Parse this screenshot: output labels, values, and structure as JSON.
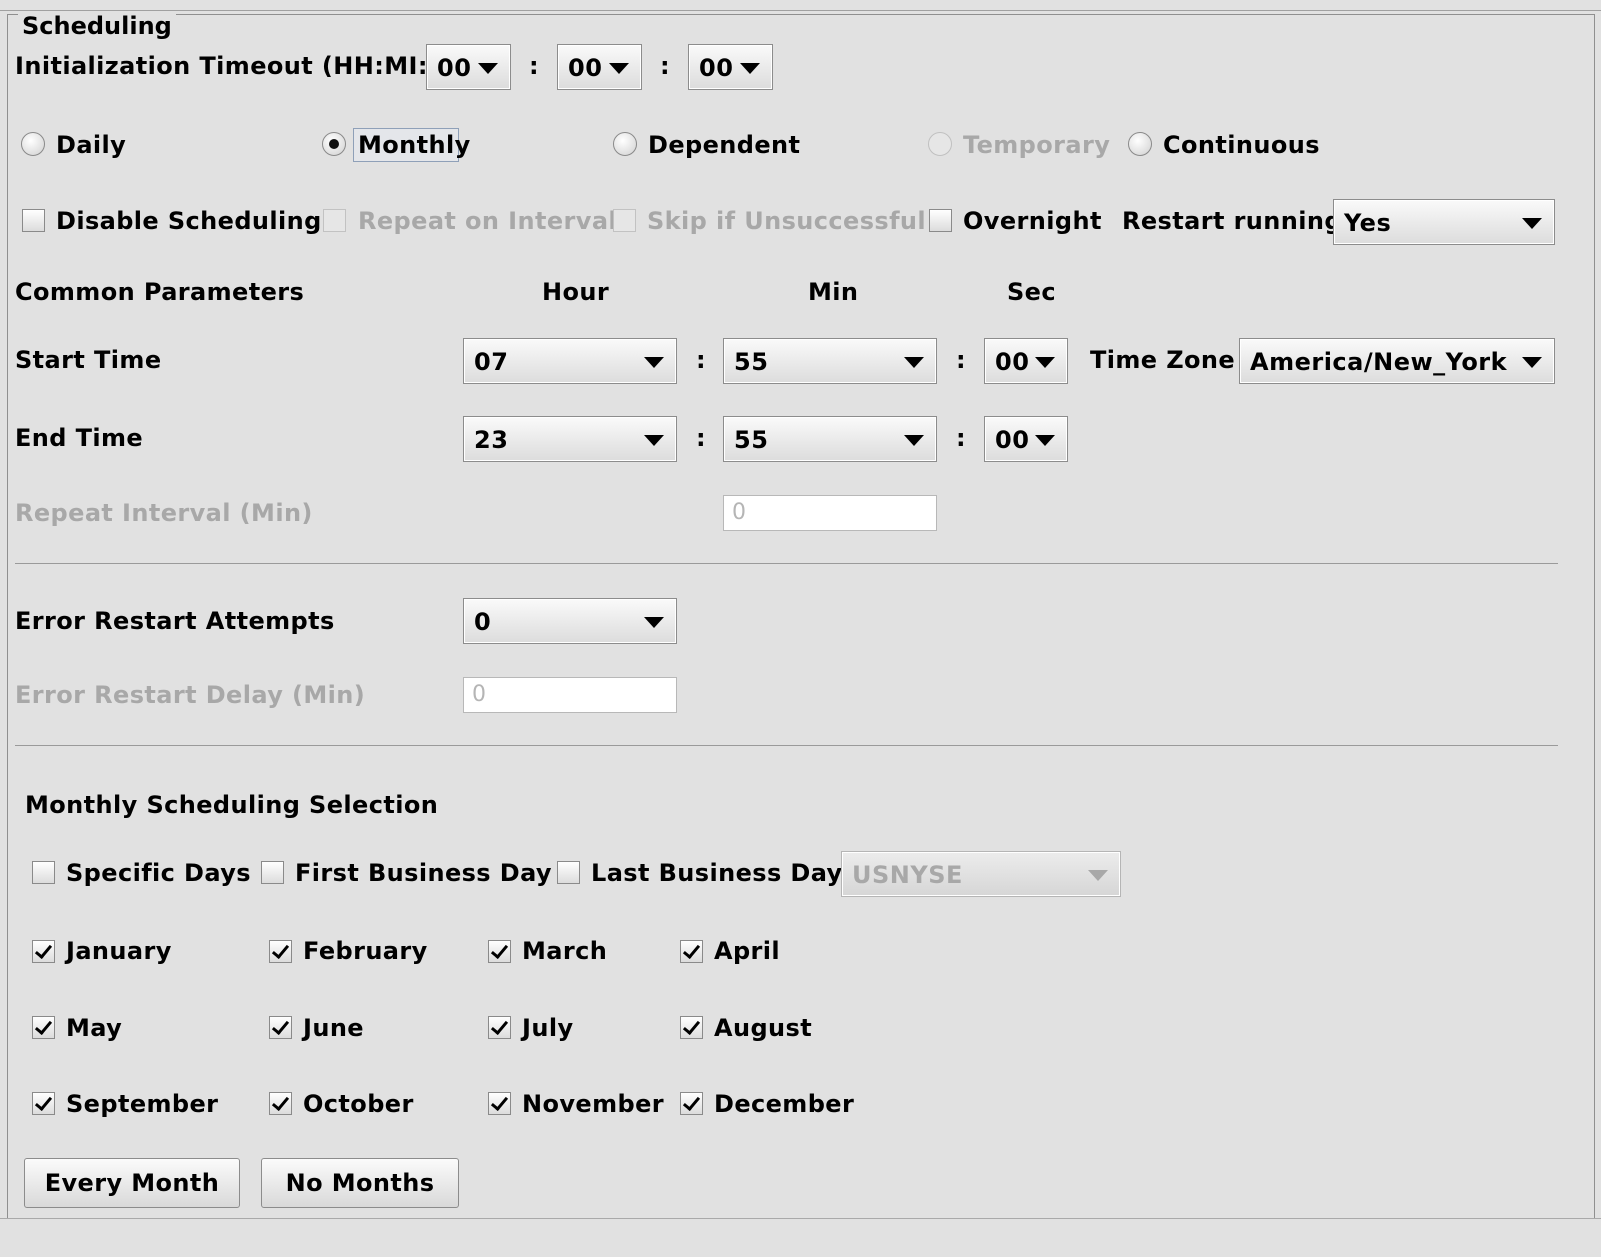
{
  "panel": {
    "title": "Scheduling"
  },
  "init_timeout": {
    "label": "Initialization Timeout (HH:MI:SS)",
    "hh": "00",
    "mi": "00",
    "ss": "00",
    "sep": ":"
  },
  "schedule_type": {
    "daily": "Daily",
    "monthly": "Monthly",
    "dependent": "Dependent",
    "temporary": "Temporary",
    "continuous": "Continuous",
    "selected": "Monthly"
  },
  "options": {
    "disable_scheduling": "Disable Scheduling",
    "repeat_on_interval": "Repeat on Interval",
    "skip_if_unsuccessful": "Skip if Unsuccessful",
    "overnight": "Overnight",
    "restart_running_label": "Restart running",
    "restart_running_value": "Yes"
  },
  "common": {
    "title": "Common Parameters",
    "hour": "Hour",
    "min": "Min",
    "sec": "Sec"
  },
  "start_time": {
    "label": "Start Time",
    "hour": "07",
    "min": "55",
    "sec": "00",
    "tz_label": "Time Zone",
    "tz_value": "America/New_York"
  },
  "end_time": {
    "label": "End Time",
    "hour": "23",
    "min": "55",
    "sec": "00"
  },
  "repeat_interval": {
    "label": "Repeat Interval (Min)",
    "value": "0"
  },
  "error_restart": {
    "attempts_label": "Error Restart Attempts",
    "attempts_value": "0",
    "delay_label": "Error Restart Delay (Min)",
    "delay_value": "0"
  },
  "monthly": {
    "title": "Monthly Scheduling Selection",
    "specific_days": "Specific Days",
    "first_business_day": "First Business Day",
    "last_business_day": "Last Business Day",
    "calendar": "USNYSE",
    "months": [
      "January",
      "February",
      "March",
      "April",
      "May",
      "June",
      "July",
      "August",
      "September",
      "October",
      "November",
      "December"
    ],
    "every_month": "Every Month",
    "no_months": "No Months"
  }
}
